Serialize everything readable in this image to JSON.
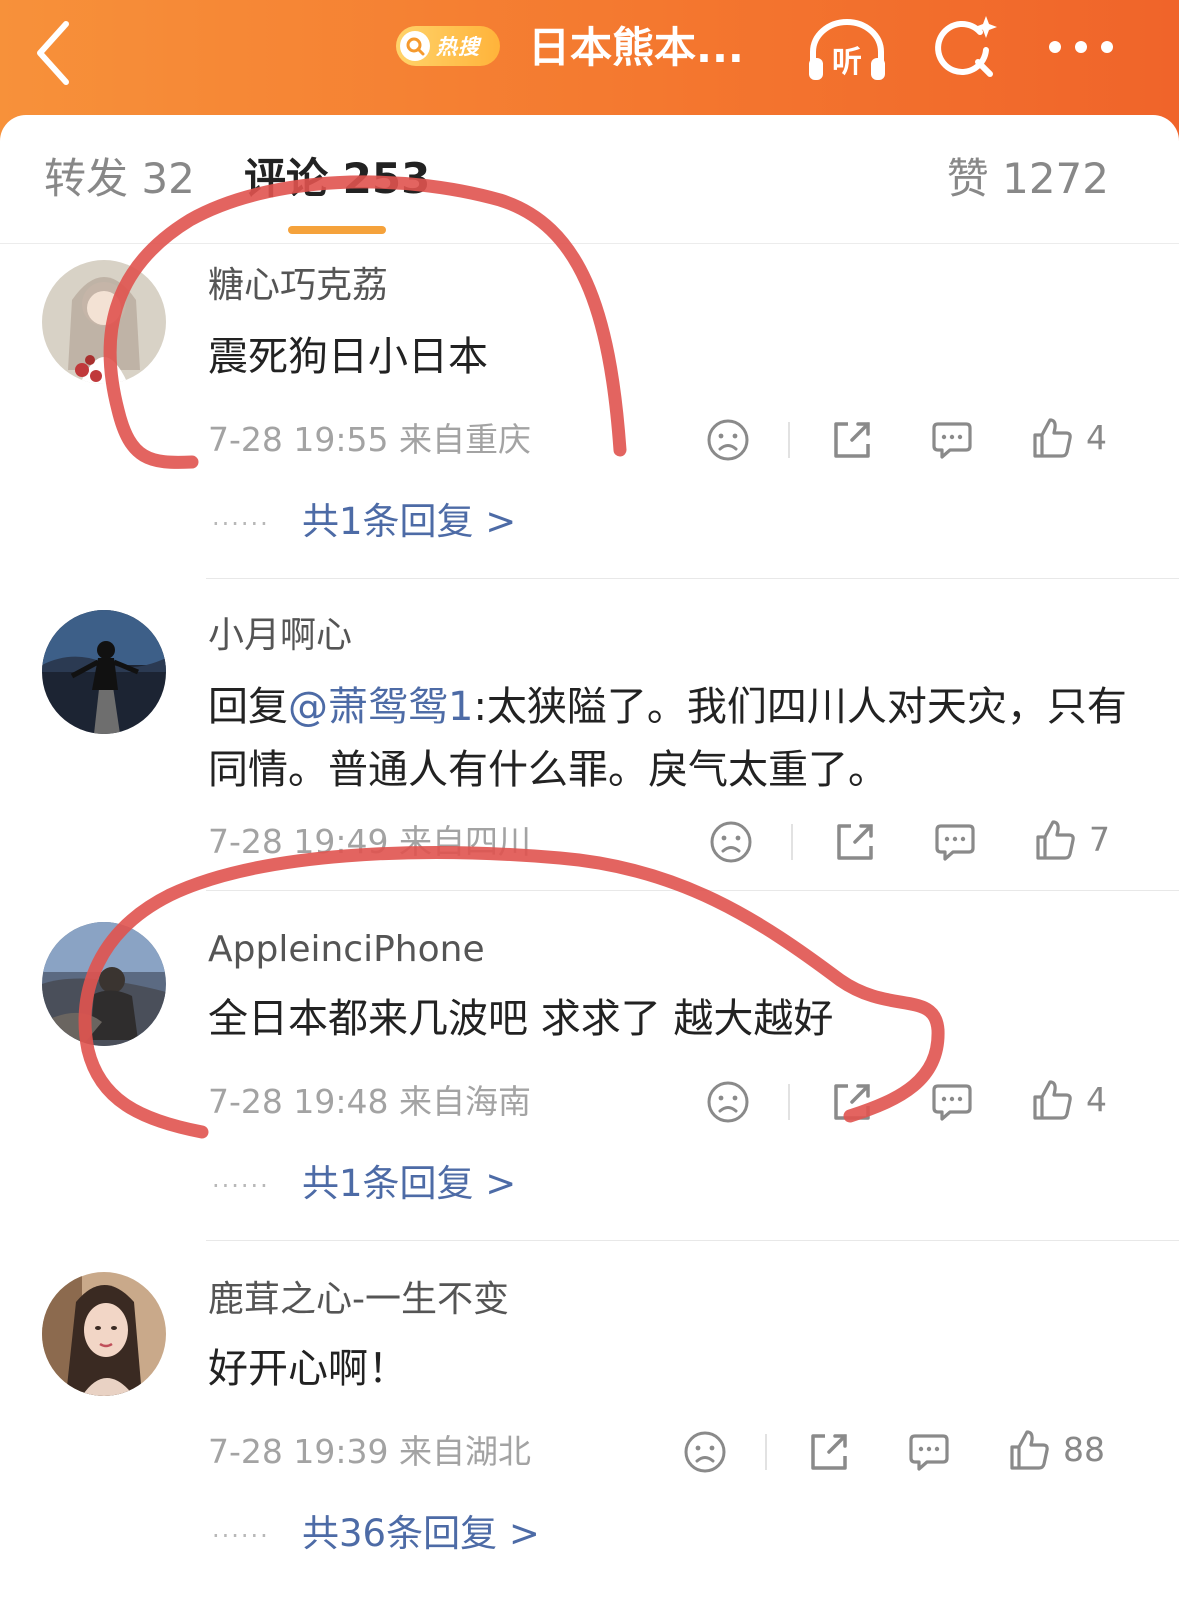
{
  "header": {
    "hot_badge": "热搜",
    "title": "日本熊本...",
    "listen_label": "听",
    "accent_color": "#f4782f"
  },
  "tabs": [
    {
      "label": "转发 32"
    },
    {
      "label": "评论 253"
    },
    {
      "label": "赞 1272"
    }
  ],
  "comments": [
    {
      "username": "糖心巧克荔",
      "content": "震死狗日小日本",
      "time": "7-28 19:55",
      "location": "来自重庆",
      "likes": "4",
      "replies_link": "共1条回复 >"
    },
    {
      "username": "小月啊心",
      "reply_prefix": "回复",
      "mention": "@萧鸳鸳1",
      "content": ":太狭隘了。我们四川人对天灾，只有同情。普通人有什么罪。戾气太重了。",
      "time": "7-28 19:49",
      "location": "来自四川",
      "likes": "7"
    },
    {
      "username": "AppleinciPhone",
      "content": "全日本都来几波吧 求求了 越大越好",
      "time": "7-28 19:48",
      "location": "来自海南",
      "likes": "4",
      "replies_link": "共1条回复 >"
    },
    {
      "username": "鹿茸之心-一生不变",
      "content": "好开心啊！",
      "time": "7-28 19:39",
      "location": "来自湖北",
      "likes": "88",
      "replies_link": "共36条回复 >"
    }
  ],
  "icons": {
    "dislike": "sad-face-icon",
    "share": "share-icon",
    "comment": "comment-bubble-icon",
    "like": "thumbs-up-icon"
  },
  "colors": {
    "link": "#4d6ba6",
    "tab_underline": "#f5a23b",
    "annotation": "#e0534f"
  }
}
